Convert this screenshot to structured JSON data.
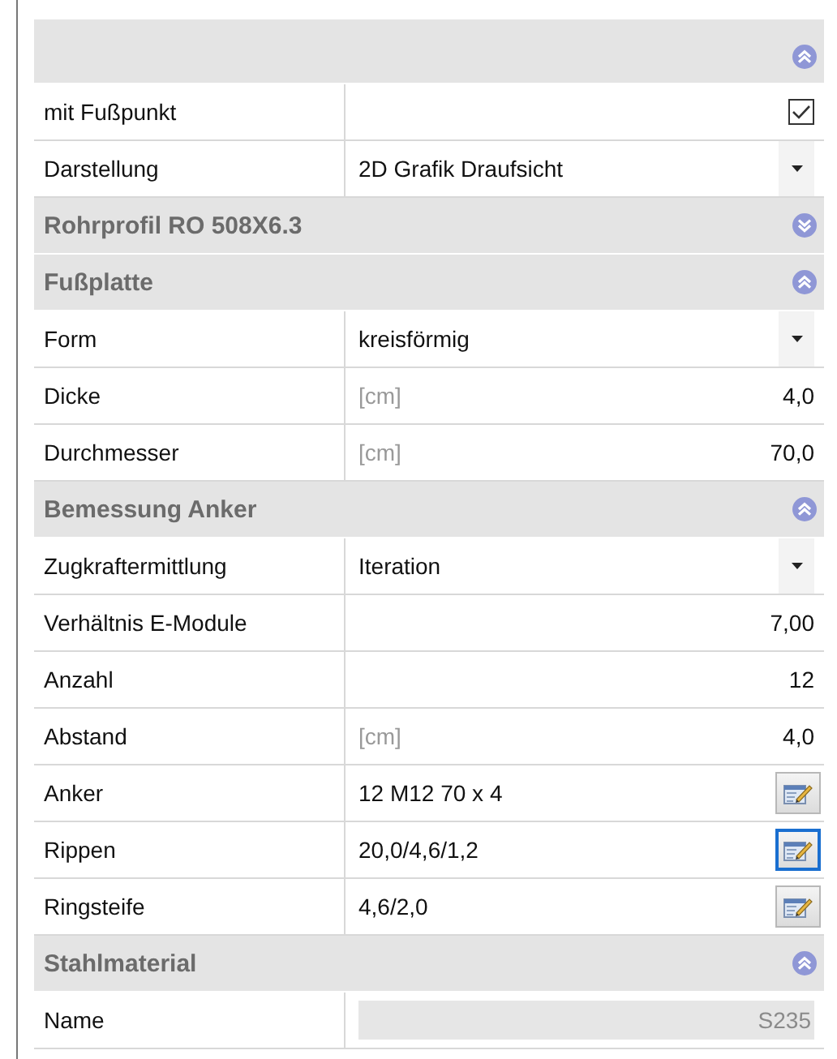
{
  "sections": [
    {
      "expanded": true,
      "rows": [
        {
          "kind": "checkbox",
          "label": "mit Fußpunkt",
          "checked": true
        },
        {
          "kind": "dropdown",
          "label": "Darstellung",
          "value": "2D Grafik Draufsicht"
        }
      ]
    },
    {
      "title": "Rohrprofil RO 508X6.3",
      "expanded": false
    },
    {
      "title": "Fußplatte",
      "expanded": true,
      "rows": [
        {
          "kind": "dropdown",
          "label": "Form",
          "value": "kreisförmig"
        },
        {
          "kind": "number",
          "label": "Dicke",
          "unit": "[cm]",
          "value": "4,0"
        },
        {
          "kind": "number",
          "label": "Durchmesser",
          "unit": "[cm]",
          "value": "70,0"
        }
      ]
    },
    {
      "title": "Bemessung Anker",
      "expanded": true,
      "rows": [
        {
          "kind": "dropdown",
          "label": "Zugkraftermittlung",
          "value": "Iteration"
        },
        {
          "kind": "number",
          "label": "Verhältnis E-Module",
          "value": "7,00"
        },
        {
          "kind": "number",
          "label": "Anzahl",
          "value": "12"
        },
        {
          "kind": "number",
          "label": "Abstand",
          "unit": "[cm]",
          "value": "4,0"
        },
        {
          "kind": "edit",
          "label": "Anker",
          "value": "12 M12 70 x 4",
          "focused": false
        },
        {
          "kind": "edit",
          "label": "Rippen",
          "value": "20,0/4,6/1,2",
          "focused": true
        },
        {
          "kind": "edit",
          "label": "Ringsteife",
          "value": "4,6/2,0",
          "focused": false
        }
      ]
    },
    {
      "title": "Stahlmaterial",
      "expanded": true,
      "rows": [
        {
          "kind": "readonly",
          "label": "Name",
          "value": "S235",
          "disabled": true
        }
      ]
    }
  ]
}
